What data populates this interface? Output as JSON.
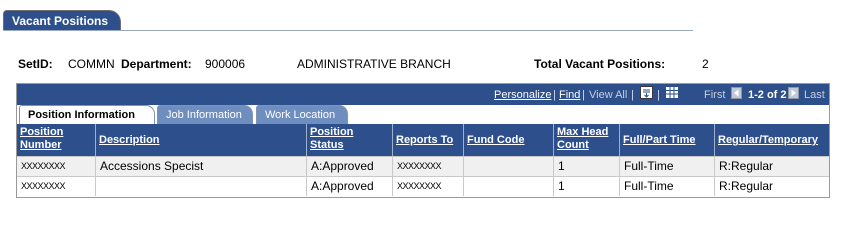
{
  "page": {
    "title": "Vacant Positions"
  },
  "summary": {
    "setid_label": "SetID:",
    "setid_value": "COMMN",
    "department_label": "Department:",
    "department_code": "900006",
    "department_name": "ADMINISTRATIVE BRANCH",
    "total_label": "Total Vacant Positions:",
    "total_value": "2"
  },
  "grid": {
    "toolbar": {
      "personalize": "Personalize",
      "pipe": "|",
      "find": "Find",
      "view_all": "View All",
      "first": "First",
      "range": "1-2 of 2",
      "last": "Last"
    },
    "tabs": [
      {
        "label": "Position Information",
        "active": true
      },
      {
        "label": "Job Information",
        "active": false
      },
      {
        "label": "Work Location",
        "active": false
      }
    ],
    "columns": [
      "Position Number",
      "Description",
      "Position Status",
      "Reports To",
      "Fund Code",
      "Max Head Count",
      "Full/Part Time",
      "Regular/Temporary"
    ],
    "rows": [
      [
        "XXXXXXXX",
        "Accessions Specist",
        "A:Approved",
        "XXXXXXXX",
        "",
        "1",
        "Full-Time",
        "R:Regular"
      ],
      [
        "XXXXXXXX",
        "",
        "A:Approved",
        "XXXXXXXX",
        "",
        "1",
        "Full-Time",
        "R:Regular"
      ]
    ]
  },
  "colors": {
    "header_blue": "#2d4f8c",
    "tab_inactive": "#6f8ec0",
    "row_even": "#ffffff",
    "row_odd": "#f0f0f0"
  },
  "icons": [
    "download-icon",
    "grid-view-icon",
    "first-arrow-icon",
    "last-arrow-icon"
  ]
}
